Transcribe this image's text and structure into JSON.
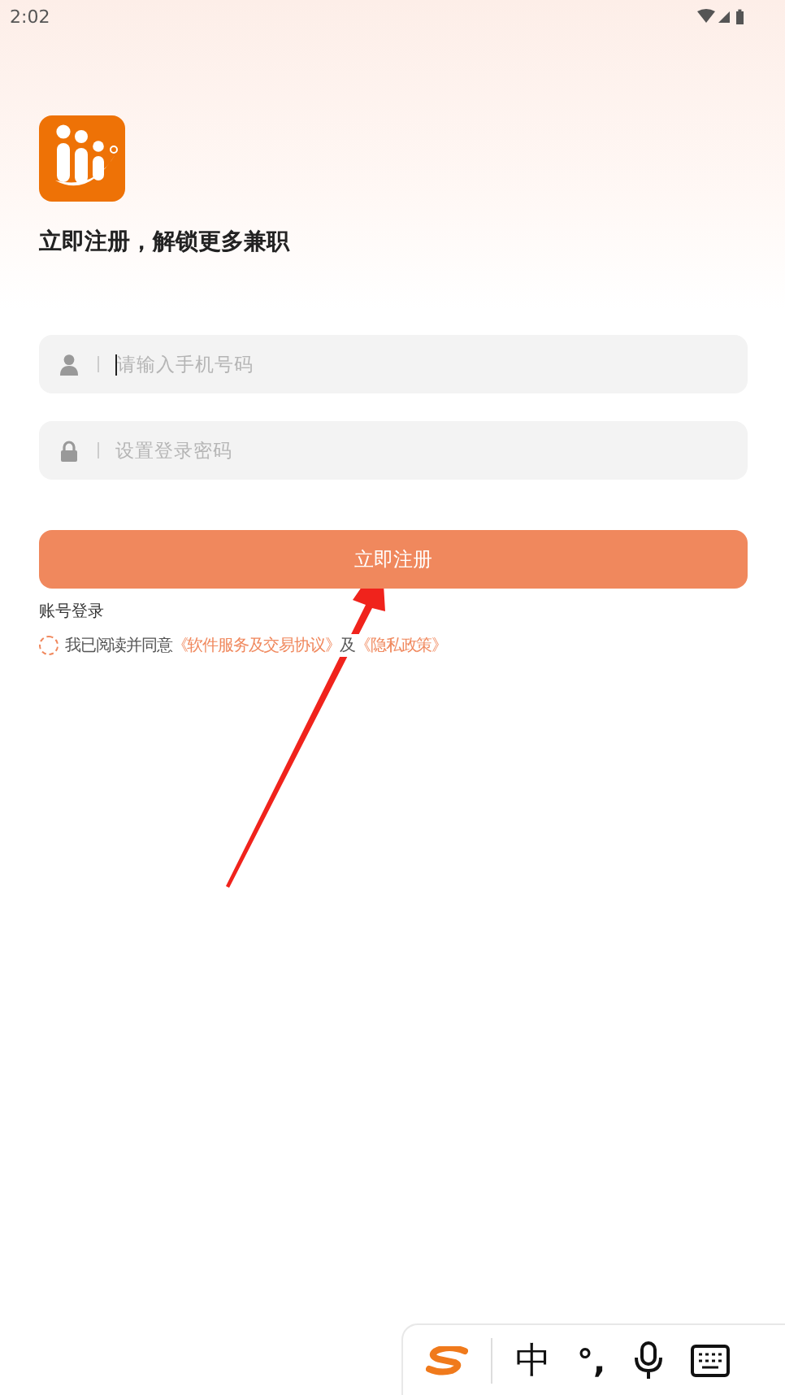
{
  "status_bar": {
    "time": "2:02"
  },
  "heading": "立即注册，解锁更多兼职",
  "fields": [
    {
      "kind": "phone",
      "placeholder": "请输入手机号码",
      "focused": true
    },
    {
      "kind": "password",
      "placeholder": "设置登录密码",
      "focused": false
    }
  ],
  "submit_button": "立即注册",
  "account_login_link": "账号登录",
  "agreement": {
    "checked": false,
    "prefix": "我已阅读并同意",
    "terms_link": "《软件服务及交易协议》",
    "joiner": "及",
    "privacy_link": "《隐私政策》"
  },
  "ime_toolbar": {
    "chinese_key": "中",
    "punctuation_key": "°,"
  }
}
